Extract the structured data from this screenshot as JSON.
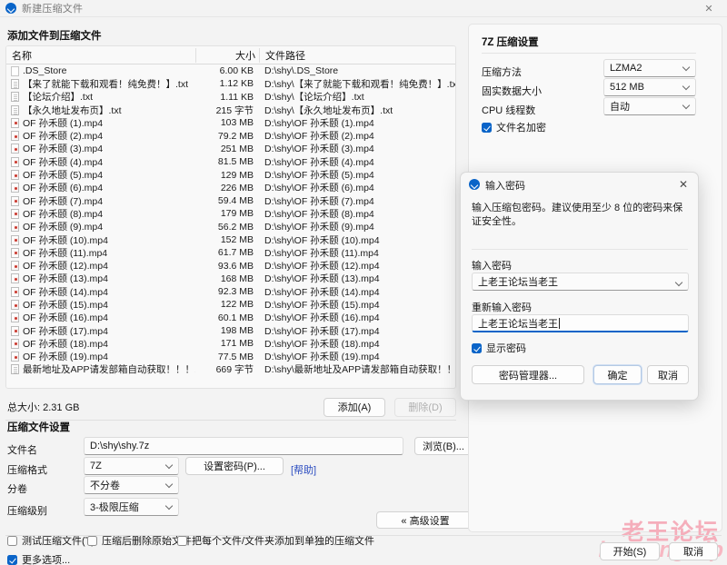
{
  "window": {
    "title": "新建压缩文件",
    "close_label": "✕"
  },
  "left": {
    "add_section_title": "添加文件到压缩文件",
    "columns": {
      "name": "名称",
      "size": "大小",
      "path": "文件路径"
    },
    "files": [
      {
        "icon": "blank-file-icon",
        "name": ".DS_Store",
        "size": "6.00 KB",
        "path": "D:\\shy\\.DS_Store"
      },
      {
        "icon": "text-file-icon",
        "name": "【来了就能下载和观看！纯免费！】.txt",
        "size": "1.12 KB",
        "path": "D:\\shy\\【来了就能下载和观看！纯免费！】.txt"
      },
      {
        "icon": "text-file-icon",
        "name": "【论坛介绍】.txt",
        "size": "1.11 KB",
        "path": "D:\\shy\\【论坛介绍】.txt"
      },
      {
        "icon": "text-file-icon",
        "name": "【永久地址发布页】.txt",
        "size": "215 字节",
        "path": "D:\\shy\\【永久地址发布页】.txt"
      },
      {
        "icon": "mp4-file-icon",
        "name": "OF 孙禾颐 (1).mp4",
        "size": "103 MB",
        "path": "D:\\shy\\OF 孙禾颐 (1).mp4"
      },
      {
        "icon": "mp4-file-icon",
        "name": "OF 孙禾颐 (2).mp4",
        "size": "79.2 MB",
        "path": "D:\\shy\\OF 孙禾颐 (2).mp4"
      },
      {
        "icon": "mp4-file-icon",
        "name": "OF 孙禾颐 (3).mp4",
        "size": "251 MB",
        "path": "D:\\shy\\OF 孙禾颐 (3).mp4"
      },
      {
        "icon": "mp4-file-icon",
        "name": "OF 孙禾颐 (4).mp4",
        "size": "81.5 MB",
        "path": "D:\\shy\\OF 孙禾颐 (4).mp4"
      },
      {
        "icon": "mp4-file-icon",
        "name": "OF 孙禾颐 (5).mp4",
        "size": "129 MB",
        "path": "D:\\shy\\OF 孙禾颐 (5).mp4"
      },
      {
        "icon": "mp4-file-icon",
        "name": "OF 孙禾颐 (6).mp4",
        "size": "226 MB",
        "path": "D:\\shy\\OF 孙禾颐 (6).mp4"
      },
      {
        "icon": "mp4-file-icon",
        "name": "OF 孙禾颐 (7).mp4",
        "size": "59.4 MB",
        "path": "D:\\shy\\OF 孙禾颐 (7).mp4"
      },
      {
        "icon": "mp4-file-icon",
        "name": "OF 孙禾颐 (8).mp4",
        "size": "179 MB",
        "path": "D:\\shy\\OF 孙禾颐 (8).mp4"
      },
      {
        "icon": "mp4-file-icon",
        "name": "OF 孙禾颐 (9).mp4",
        "size": "56.2 MB",
        "path": "D:\\shy\\OF 孙禾颐 (9).mp4"
      },
      {
        "icon": "mp4-file-icon",
        "name": "OF 孙禾颐 (10).mp4",
        "size": "152 MB",
        "path": "D:\\shy\\OF 孙禾颐 (10).mp4"
      },
      {
        "icon": "mp4-file-icon",
        "name": "OF 孙禾颐 (11).mp4",
        "size": "61.7 MB",
        "path": "D:\\shy\\OF 孙禾颐 (11).mp4"
      },
      {
        "icon": "mp4-file-icon",
        "name": "OF 孙禾颐 (12).mp4",
        "size": "93.6 MB",
        "path": "D:\\shy\\OF 孙禾颐 (12).mp4"
      },
      {
        "icon": "mp4-file-icon",
        "name": "OF 孙禾颐 (13).mp4",
        "size": "168 MB",
        "path": "D:\\shy\\OF 孙禾颐 (13).mp4"
      },
      {
        "icon": "mp4-file-icon",
        "name": "OF 孙禾颐 (14).mp4",
        "size": "92.3 MB",
        "path": "D:\\shy\\OF 孙禾颐 (14).mp4"
      },
      {
        "icon": "mp4-file-icon",
        "name": "OF 孙禾颐 (15).mp4",
        "size": "122 MB",
        "path": "D:\\shy\\OF 孙禾颐 (15).mp4"
      },
      {
        "icon": "mp4-file-icon",
        "name": "OF 孙禾颐 (16).mp4",
        "size": "60.1 MB",
        "path": "D:\\shy\\OF 孙禾颐 (16).mp4"
      },
      {
        "icon": "mp4-file-icon",
        "name": "OF 孙禾颐 (17).mp4",
        "size": "198 MB",
        "path": "D:\\shy\\OF 孙禾颐 (17).mp4"
      },
      {
        "icon": "mp4-file-icon",
        "name": "OF 孙禾颐 (18).mp4",
        "size": "171 MB",
        "path": "D:\\shy\\OF 孙禾颐 (18).mp4"
      },
      {
        "icon": "mp4-file-icon",
        "name": "OF 孙禾颐 (19).mp4",
        "size": "77.5 MB",
        "path": "D:\\shy\\OF 孙禾颐 (19).mp4"
      },
      {
        "icon": "text-file-icon",
        "name": "最新地址及APP请发部箱自动获取！！！.txt",
        "size": "669 字节",
        "path": "D:\\shy\\最新地址及APP请发部箱自动获取！！！.txt"
      }
    ],
    "total_size": "总大小: 2.31 GB",
    "add_button": "添加(A)",
    "delete_button": "删除(D)",
    "archive_section_title": "压缩文件设置",
    "filename_label": "文件名",
    "filename_value": "D:\\shy\\shy.7z",
    "browse_button": "浏览(B)...",
    "format_label": "压缩格式",
    "format_value": "7Z",
    "set_password_button": "设置密码(P)...",
    "help_link": "[帮助]",
    "volume_label": "分卷",
    "volume_value": "不分卷",
    "level_label": "压缩级别",
    "level_value": "3-极限压缩",
    "advanced_button": "« 高级设置",
    "check_test": "测试压缩文件(T)",
    "check_delete_source": "压缩后删除原始文件",
    "check_separate": "把每个文件/文件夹添加到单独的压缩文件",
    "check_more_options": "更多选项..."
  },
  "right": {
    "title": "7Z 压缩设置",
    "method_label": "压缩方法",
    "method_value": "LZMA2",
    "solid_label": "固实数据大小",
    "solid_value": "512 MB",
    "threads_label": "CPU 线程数",
    "threads_value": "自动",
    "encrypt_names_label": "文件名加密"
  },
  "dialog": {
    "title": "输入密码",
    "close_label": "✕",
    "description": "输入压缩包密码。建议使用至少 8 位的密码来保证安全性。",
    "password_label": "输入密码",
    "password_value": "上老王论坛当老王",
    "confirm_label": "重新输入密码",
    "confirm_value": "上老王论坛当老王",
    "show_password_label": "显示密码",
    "manager_button": "密码管理器...",
    "ok_button": "确定",
    "cancel_button": "取消"
  },
  "footer": {
    "start_button": "开始(S)",
    "cancel_button": "取消"
  },
  "watermark": {
    "line1": "老王论坛",
    "line2": "laowang.vip"
  },
  "colors": {
    "accent": "#0a64c8",
    "link": "#2b4cc0",
    "watermark": "#f5aebb",
    "window_bg": "#f3f3f3"
  }
}
